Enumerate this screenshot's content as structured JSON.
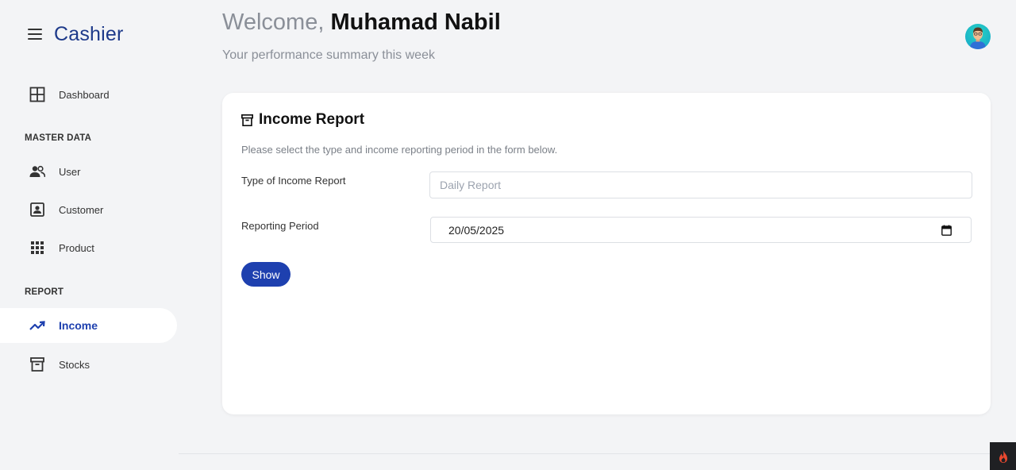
{
  "app": {
    "title": "Cashier"
  },
  "sidebar": {
    "items": [
      {
        "label": "Dashboard",
        "icon": "dashboard-grid-icon"
      },
      {
        "label": "User",
        "icon": "users-icon"
      },
      {
        "label": "Customer",
        "icon": "contact-card-icon"
      },
      {
        "label": "Product",
        "icon": "apps-grid-icon"
      },
      {
        "label": "Income",
        "icon": "trending-up-icon",
        "active": true
      },
      {
        "label": "Stocks",
        "icon": "archive-box-icon"
      }
    ],
    "sections": {
      "master_data": "MASTER DATA",
      "report": "REPORT"
    }
  },
  "header": {
    "welcome_prefix": "Welcome,",
    "user_name": "Muhamad Nabil",
    "subtitle": "Your performance summary this week"
  },
  "card": {
    "title": "Income Report",
    "description": "Please select the type and income reporting period in the form below.",
    "type_label": "Type of Income Report",
    "type_placeholder": "Daily Report",
    "period_label": "Reporting Period",
    "period_value": "20/05/2025",
    "show_button": "Show"
  },
  "colors": {
    "accent": "#1e40af",
    "brand": "#1e3a8a",
    "background": "#f3f4f6"
  }
}
